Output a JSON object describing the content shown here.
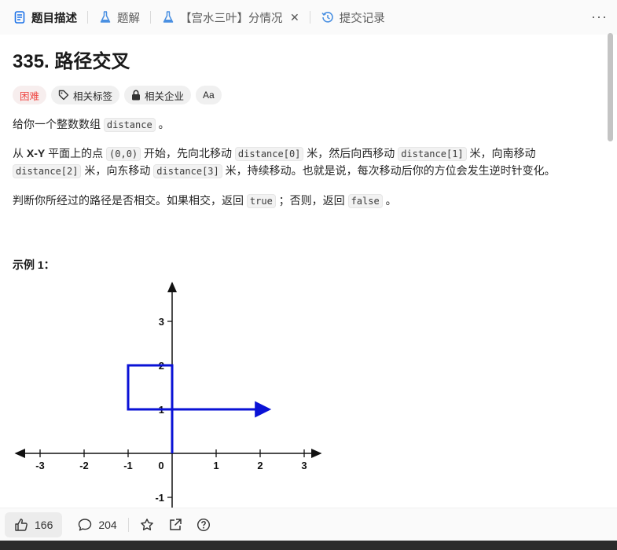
{
  "tabs": [
    {
      "label": "题目描述",
      "active": true
    },
    {
      "label": "题解"
    },
    {
      "label": "【宫水三叶】分情况"
    },
    {
      "label": "提交记录"
    }
  ],
  "problem": {
    "title": "335. 路径交叉",
    "tags": [
      "困难",
      "相关标签",
      "相关企业",
      "Aa"
    ]
  },
  "desc": {
    "p1_a": "给你一个整数数组 ",
    "p1_code": "distance",
    "p1_b": " 。",
    "p2_a": "从 ",
    "p2_bold": "X-Y",
    "p2_b": " 平面上的点 ",
    "p2_code0": "(0,0)",
    "p2_c": " 开始，先向北移动 ",
    "p2_code1": "distance[0]",
    "p2_d": " 米，然后向西移动 ",
    "p2_code2": "distance[1]",
    "p2_e": " 米，向南移动",
    "p2_code3": "distance[2]",
    "p2_f": " 米，向东移动 ",
    "p2_code4": "distance[3]",
    "p2_g": " 米，持续移动。也就是说，每次移动后你的方位会发生逆时针变化。",
    "p3_a": "判断你所经过的路径是否相交。如果相交，返回 ",
    "p3_code1": "true",
    "p3_b": " ；否则，返回 ",
    "p3_code2": "false",
    "p3_c": " 。"
  },
  "example": {
    "heading": "示例 1：",
    "x_ticks": [
      "-3",
      "-2",
      "-1",
      "0",
      "1",
      "2",
      "3"
    ],
    "y_ticks": [
      "3",
      "2",
      "1",
      "-1"
    ],
    "path_points": [
      [
        0,
        0
      ],
      [
        0,
        2
      ],
      [
        -1,
        2
      ],
      [
        -1,
        1
      ],
      [
        2.2,
        1
      ]
    ],
    "path_color": "#0a12d6"
  },
  "bottom": {
    "likes": "166",
    "comments": "204"
  }
}
